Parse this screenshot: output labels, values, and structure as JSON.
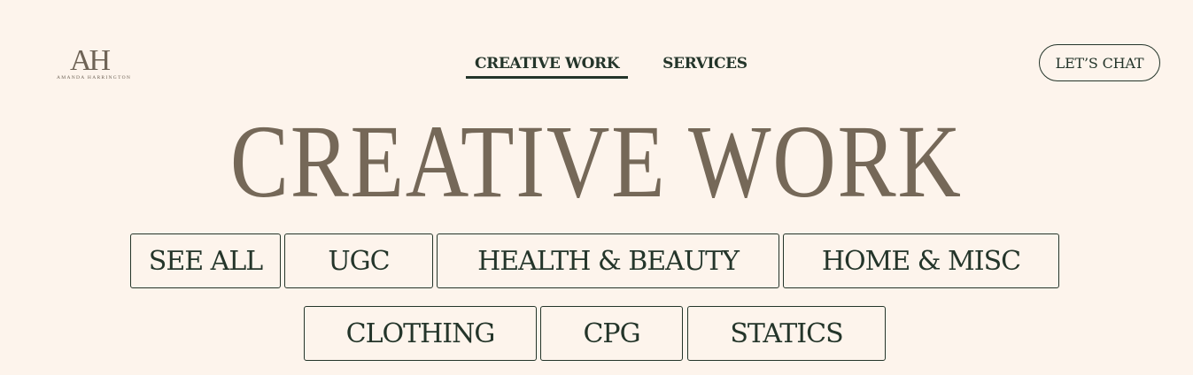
{
  "logo": {
    "monogram": "AH",
    "name": "AMANDA HARRINGTON"
  },
  "nav": {
    "items": [
      {
        "label": "CREATIVE WORK",
        "active": true
      },
      {
        "label": "SERVICES",
        "active": false
      }
    ]
  },
  "header": {
    "cta_label": "LET’S CHAT"
  },
  "hero": {
    "title": "CREATIVE WORK"
  },
  "filters": {
    "row1": [
      "SEE ALL",
      "UGC",
      "HEALTH & BEAUTY",
      "HOME & MISC"
    ],
    "row2": [
      "CLOTHING",
      "CPG",
      "STATICS"
    ]
  },
  "colors": {
    "background": "#fdf4ec",
    "text": "#24352a",
    "accent_taupe": "#756858"
  }
}
